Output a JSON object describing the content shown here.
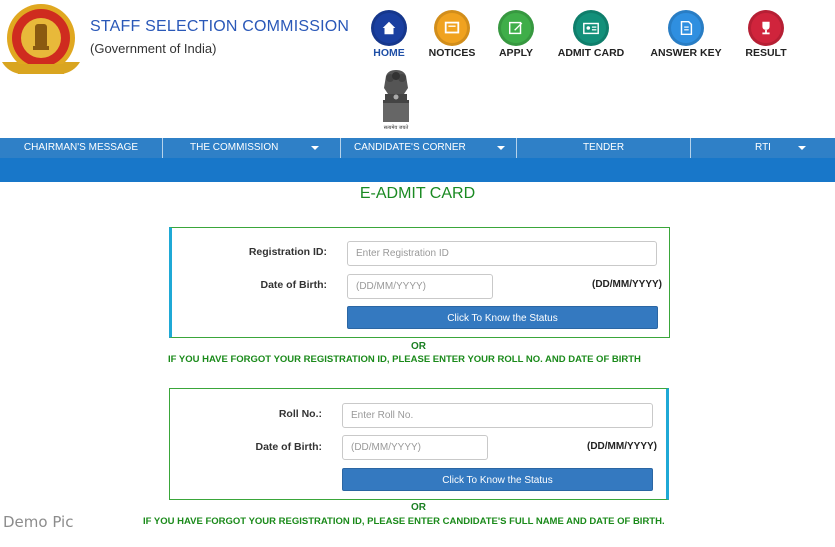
{
  "header": {
    "org_name": "STAFF SELECTION COMMISSION",
    "org_sub": "(Government of India)",
    "emblem_caption": "सत्यमेव जयते"
  },
  "nav_icons": [
    {
      "label": "HOME",
      "icon": "home-icon",
      "color": "#1a3fa0",
      "active": true
    },
    {
      "label": "NOTICES",
      "icon": "notice-board-icon",
      "color": "#f0a21f"
    },
    {
      "label": "APPLY",
      "icon": "edit-icon",
      "color": "#3fae49"
    },
    {
      "label": "ADMIT CARD",
      "icon": "id-card-icon",
      "color": "#12907a"
    },
    {
      "label": "ANSWER KEY",
      "icon": "document-icon",
      "color": "#2f8fe0"
    },
    {
      "label": "RESULT",
      "icon": "trophy-icon",
      "color": "#d0243c"
    }
  ],
  "menu": [
    {
      "label": "CHAIRMAN'S MESSAGE",
      "has_dropdown": false
    },
    {
      "label": "THE COMMISSION",
      "has_dropdown": true
    },
    {
      "label": "CANDIDATE'S CORNER",
      "has_dropdown": true
    },
    {
      "label": "TENDER",
      "has_dropdown": false
    },
    {
      "label": "RTI",
      "has_dropdown": true
    }
  ],
  "page_title": "E-ADMIT CARD",
  "form1": {
    "reg_label": "Registration ID:",
    "reg_placeholder": "Enter Registration ID",
    "dob_label": "Date of Birth:",
    "dob_placeholder": "(DD/MM/YYYY)",
    "dob_format": "(DD/MM/YYYY)",
    "button": "Click To Know the Status"
  },
  "or_1": "OR",
  "hint_1": "IF YOU HAVE FORGOT YOUR REGISTRATION ID, PLEASE ENTER YOUR ROLL NO. AND DATE OF BIRTH",
  "form2": {
    "roll_label": "Roll No.:",
    "roll_placeholder": "Enter Roll No.",
    "dob_label": "Date of Birth:",
    "dob_placeholder": "(DD/MM/YYYY)",
    "dob_format": "(DD/MM/YYYY)",
    "button": "Click To Know the Status"
  },
  "or_2": "OR",
  "hint_2": "IF YOU HAVE FORGOT YOUR REGISTRATION ID, PLEASE ENTER CANDIDATE'S FULL NAME AND DATE OF BIRTH.",
  "watermark": "Demo Pic",
  "colors": {
    "menu_bar": "#2f80c7",
    "green_text": "#1a8a22",
    "button": "#3479c0",
    "accent": "#1fa9d6"
  }
}
